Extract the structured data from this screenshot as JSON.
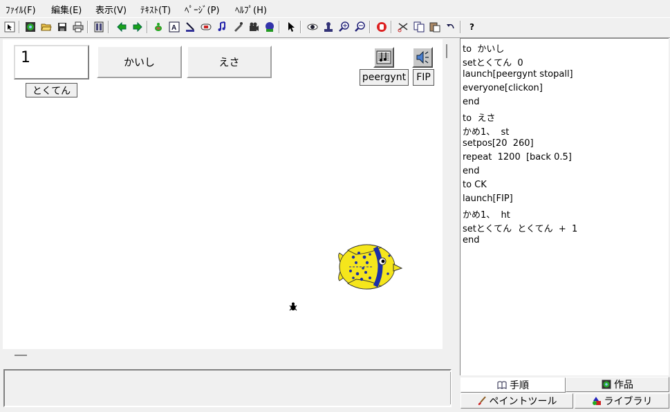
{
  "menu": [
    "ﾌｧｲﾙ(F)",
    "編集(E)",
    "表示(V)",
    "ﾃｷｽﾄ(T)",
    "ﾍﾟｰｼﾞ(P)",
    "ﾍﾙﾌﾟ(H)"
  ],
  "toolbar": {
    "buttons": [
      "select-arrow-icon",
      "globe-icon",
      "open-folder-icon",
      "save-icon",
      "print-icon",
      "page-icon",
      "back-arrow-icon",
      "forward-arrow-icon",
      "turtle-icon",
      "text-icon",
      "button-tool-icon",
      "slider-icon",
      "music-icon",
      "pen-icon",
      "movie-icon",
      "camera-icon",
      "pointer-icon",
      "eye-icon",
      "stamp-icon",
      "zoom-in-icon",
      "zoom-out-icon",
      "stop-hand-icon",
      "scissors-icon",
      "copy-icon",
      "paste-icon",
      "undo-icon",
      "help-icon"
    ],
    "help_label": "?"
  },
  "canvas": {
    "score_value": "1",
    "score_label": "とくてん",
    "button_kaishi": "かいし",
    "button_esa": "えさ",
    "music_label": "peergynt",
    "sound_label": "FIP"
  },
  "procedures": [
    "to  かいし",
    "setとくてん  0",
    "launch[peergynt stopall]",
    "everyone[clickon]",
    "end",
    "to  えさ",
    "かめ1、  st",
    "setpos[20  260]",
    "repeat  1200  [back 0.5]",
    "end",
    "to CK",
    "launch[FIP]",
    "かめ1、  ht",
    "setとくてん  とくてん  +  1",
    "end"
  ],
  "tabs": {
    "procedures": "手順",
    "project": "作品",
    "paint_tools": "ペイントツール",
    "library": "ライブラリ"
  },
  "colors": {
    "fish_yellow": "#f5e61c",
    "fish_blue": "#1b2fa8",
    "window_bg": "#f0f0f0"
  }
}
